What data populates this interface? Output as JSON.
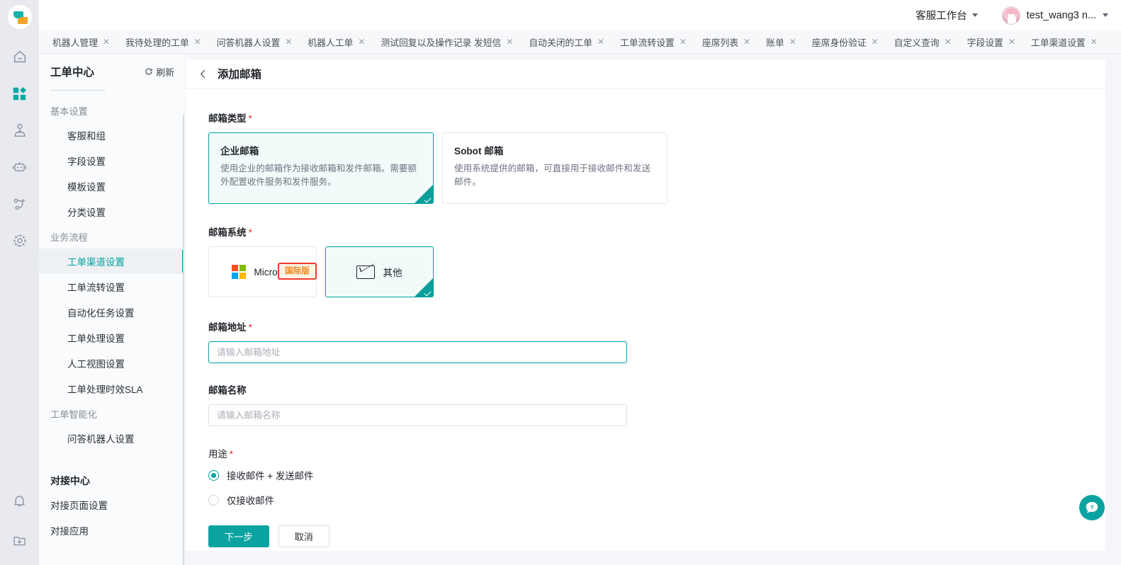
{
  "header": {
    "workbench_label": "客服工作台",
    "user_name": "test_wang3 n...",
    "logo_name": "sobot-logo"
  },
  "tabs": [
    {
      "label": "机器人管理"
    },
    {
      "label": "我待处理的工单"
    },
    {
      "label": "问答机器人设置"
    },
    {
      "label": "机器人工单"
    },
    {
      "label": "测试回复以及操作记录 发短信"
    },
    {
      "label": "自动关闭的工单"
    },
    {
      "label": "工单流转设置"
    },
    {
      "label": "座席列表"
    },
    {
      "label": "账单"
    },
    {
      "label": "座席身份验证"
    },
    {
      "label": "自定义查询"
    },
    {
      "label": "字段设置"
    },
    {
      "label": "工单渠道设置"
    }
  ],
  "tab_close_glyph": "✕",
  "rail": {
    "icons": [
      {
        "name": "home-icon",
        "active": false
      },
      {
        "name": "apps-grid-icon",
        "active": true
      },
      {
        "name": "agent-person-icon",
        "active": false
      },
      {
        "name": "robot-icon",
        "active": false
      },
      {
        "name": "workflow-icon",
        "active": false
      },
      {
        "name": "gear-icon",
        "active": false
      }
    ],
    "bottom_icons": [
      {
        "name": "bell-icon"
      },
      {
        "name": "download-folder-icon"
      }
    ]
  },
  "subnav": {
    "title": "工单中心",
    "refresh_label": "刷新",
    "groups": [
      {
        "group_label": "基本设置",
        "items": [
          {
            "label": "客服和组",
            "selected": false
          },
          {
            "label": "字段设置",
            "selected": false
          },
          {
            "label": "模板设置",
            "selected": false
          },
          {
            "label": "分类设置",
            "selected": false
          }
        ]
      },
      {
        "group_label": "业务流程",
        "items": [
          {
            "label": "工单渠道设置",
            "selected": true
          },
          {
            "label": "工单流转设置",
            "selected": false
          },
          {
            "label": "自动化任务设置",
            "selected": false
          },
          {
            "label": "工单处理设置",
            "selected": false
          },
          {
            "label": "人工视图设置",
            "selected": false
          },
          {
            "label": "工单处理时效SLA",
            "selected": false
          }
        ]
      },
      {
        "group_label": "工单智能化",
        "items": [
          {
            "label": "问答机器人设置",
            "selected": false
          }
        ]
      }
    ],
    "section2_title": "对接中心",
    "section2_items": [
      {
        "label": "对接页面设置"
      },
      {
        "label": "对接应用"
      }
    ]
  },
  "main": {
    "page_title": "添加邮箱",
    "mailbox_type": {
      "label": "邮箱类型",
      "required": true,
      "options": [
        {
          "name": "企业邮箱",
          "desc": "使用企业的邮箱作为接收邮箱和发件邮箱。需要额外配置收件服务和发件服务。",
          "selected": true
        },
        {
          "name": "Sobot 邮箱",
          "desc": "使用系统提供的邮箱，可直接用于接收邮件和发送邮件。",
          "selected": false
        }
      ]
    },
    "mailbox_system": {
      "label": "邮箱系统",
      "required": true,
      "badge": "国际版",
      "options": [
        {
          "name": "Microsoft",
          "icon": "microsoft-logo-icon",
          "selected": false
        },
        {
          "name": "其他",
          "icon": "envelope-icon",
          "selected": true
        }
      ]
    },
    "mailbox_address": {
      "label": "邮箱地址",
      "required": true,
      "value": "",
      "placeholder": "请输入邮箱地址",
      "focused": true
    },
    "mailbox_name": {
      "label": "邮箱名称",
      "required": false,
      "value": "",
      "placeholder": "请输入邮箱名称",
      "focused": false
    },
    "usage": {
      "label": "用途",
      "required": true,
      "options": [
        {
          "label": "接收邮件 + 发送邮件",
          "checked": true
        },
        {
          "label": "仅接收邮件",
          "checked": false
        }
      ]
    },
    "actions": {
      "next_label": "下一步",
      "cancel_label": "取消"
    }
  },
  "colors": {
    "accent": "#00a0a0",
    "primary_button": "#0aa3a0",
    "required_star": "#f5222d",
    "badge_text": "#f08519",
    "highlight_border": "#f5392b"
  }
}
